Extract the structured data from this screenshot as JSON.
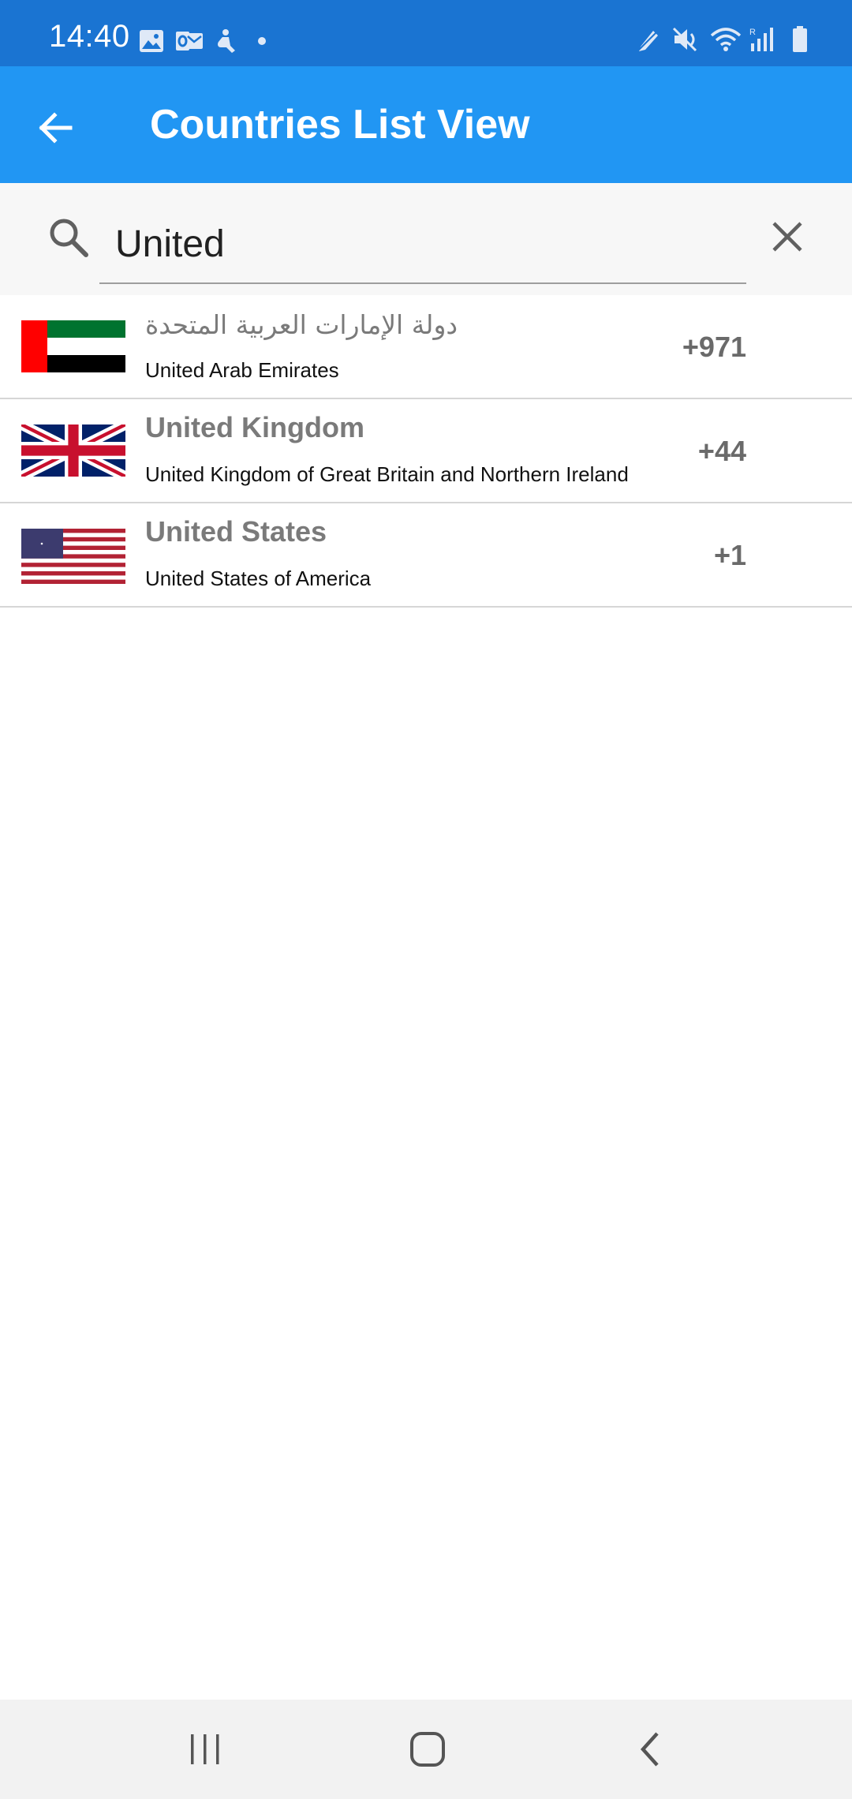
{
  "status_bar": {
    "time": "14:40",
    "left_icons": [
      "gallery-icon",
      "outlook-icon",
      "accessibility-icon",
      "dot-icon"
    ],
    "right_icons": [
      "edge-panel-icon",
      "mute-icon",
      "wifi-icon",
      "signal-icon",
      "battery-icon"
    ]
  },
  "app_bar": {
    "title": "Countries List View",
    "back_icon": "arrow-back-icon"
  },
  "search": {
    "value": "United",
    "icon": "search-icon",
    "clear_icon": "close-icon"
  },
  "countries": [
    {
      "native_name": "دولة الإمارات العربية المتحدة",
      "official_name": "United Arab Emirates",
      "dial_code": "+971",
      "flag": "uae-flag"
    },
    {
      "native_name": "United Kingdom",
      "official_name": "United Kingdom of Great Britain and Northern Ireland",
      "dial_code": "+44",
      "flag": "uk-flag"
    },
    {
      "native_name": "United States",
      "official_name": "United States of America",
      "dial_code": "+1",
      "flag": "us-flag"
    }
  ],
  "nav_bar": {
    "buttons": [
      "recents-icon",
      "home-icon",
      "back-nav-icon"
    ]
  },
  "colors": {
    "status_bar": "#1a74d2",
    "app_bar": "#2196f3",
    "search_bg": "#f7f7f7",
    "nav_bg": "#f2f2f2"
  }
}
